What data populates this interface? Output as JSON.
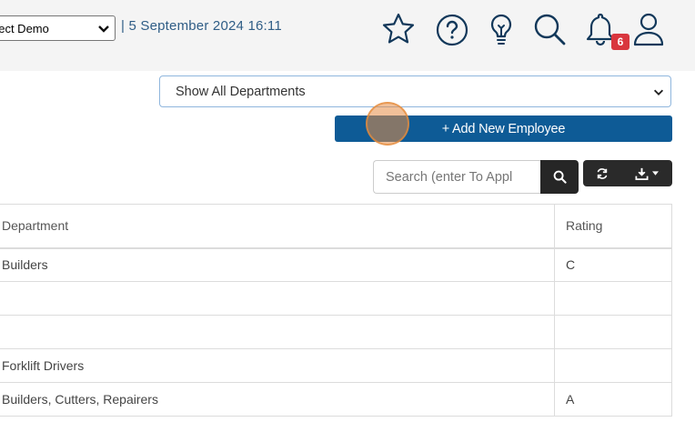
{
  "header": {
    "company": "nect Demo",
    "datetime": "| 5 September 2024 16:11",
    "notification_count": "6",
    "icons": [
      "star-icon",
      "help-icon",
      "lightbulb-icon",
      "search-icon",
      "bell-icon",
      "user-icon"
    ]
  },
  "filters": {
    "department_select": "Show All Departments"
  },
  "actions": {
    "add_employee": "+ Add New Employee"
  },
  "search": {
    "placeholder": "Search (enter To Appl"
  },
  "table": {
    "columns": [
      "Department",
      "Rating"
    ],
    "rows": [
      {
        "department": "Builders",
        "rating": "C"
      },
      {
        "department": "",
        "rating": ""
      },
      {
        "department": "",
        "rating": ""
      },
      {
        "department": "Forklift Drivers",
        "rating": ""
      },
      {
        "department": "Builders, Cutters, Repairers",
        "rating": "A"
      }
    ]
  },
  "colors": {
    "primary": "#0e5b96",
    "dark_button": "#262626",
    "badge": "#d9363e",
    "date_text": "#2f5d86",
    "topbar_bg": "#f4f4f4"
  }
}
